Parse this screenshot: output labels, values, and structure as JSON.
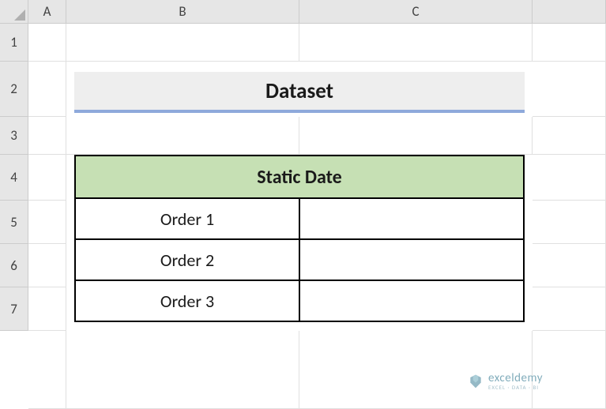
{
  "columns": {
    "A": "A",
    "B": "B",
    "C": "C"
  },
  "rows": {
    "r1": "1",
    "r2": "2",
    "r3": "3",
    "r4": "4",
    "r5": "5",
    "r6": "6",
    "r7": "7"
  },
  "title": "Dataset",
  "table": {
    "header": "Static Date",
    "rows": [
      {
        "label": "Order 1",
        "value": ""
      },
      {
        "label": "Order 2",
        "value": ""
      },
      {
        "label": "Order 3",
        "value": ""
      }
    ]
  },
  "watermark": {
    "name": "exceldemy",
    "sub": "EXCEL · DATA · BI"
  }
}
